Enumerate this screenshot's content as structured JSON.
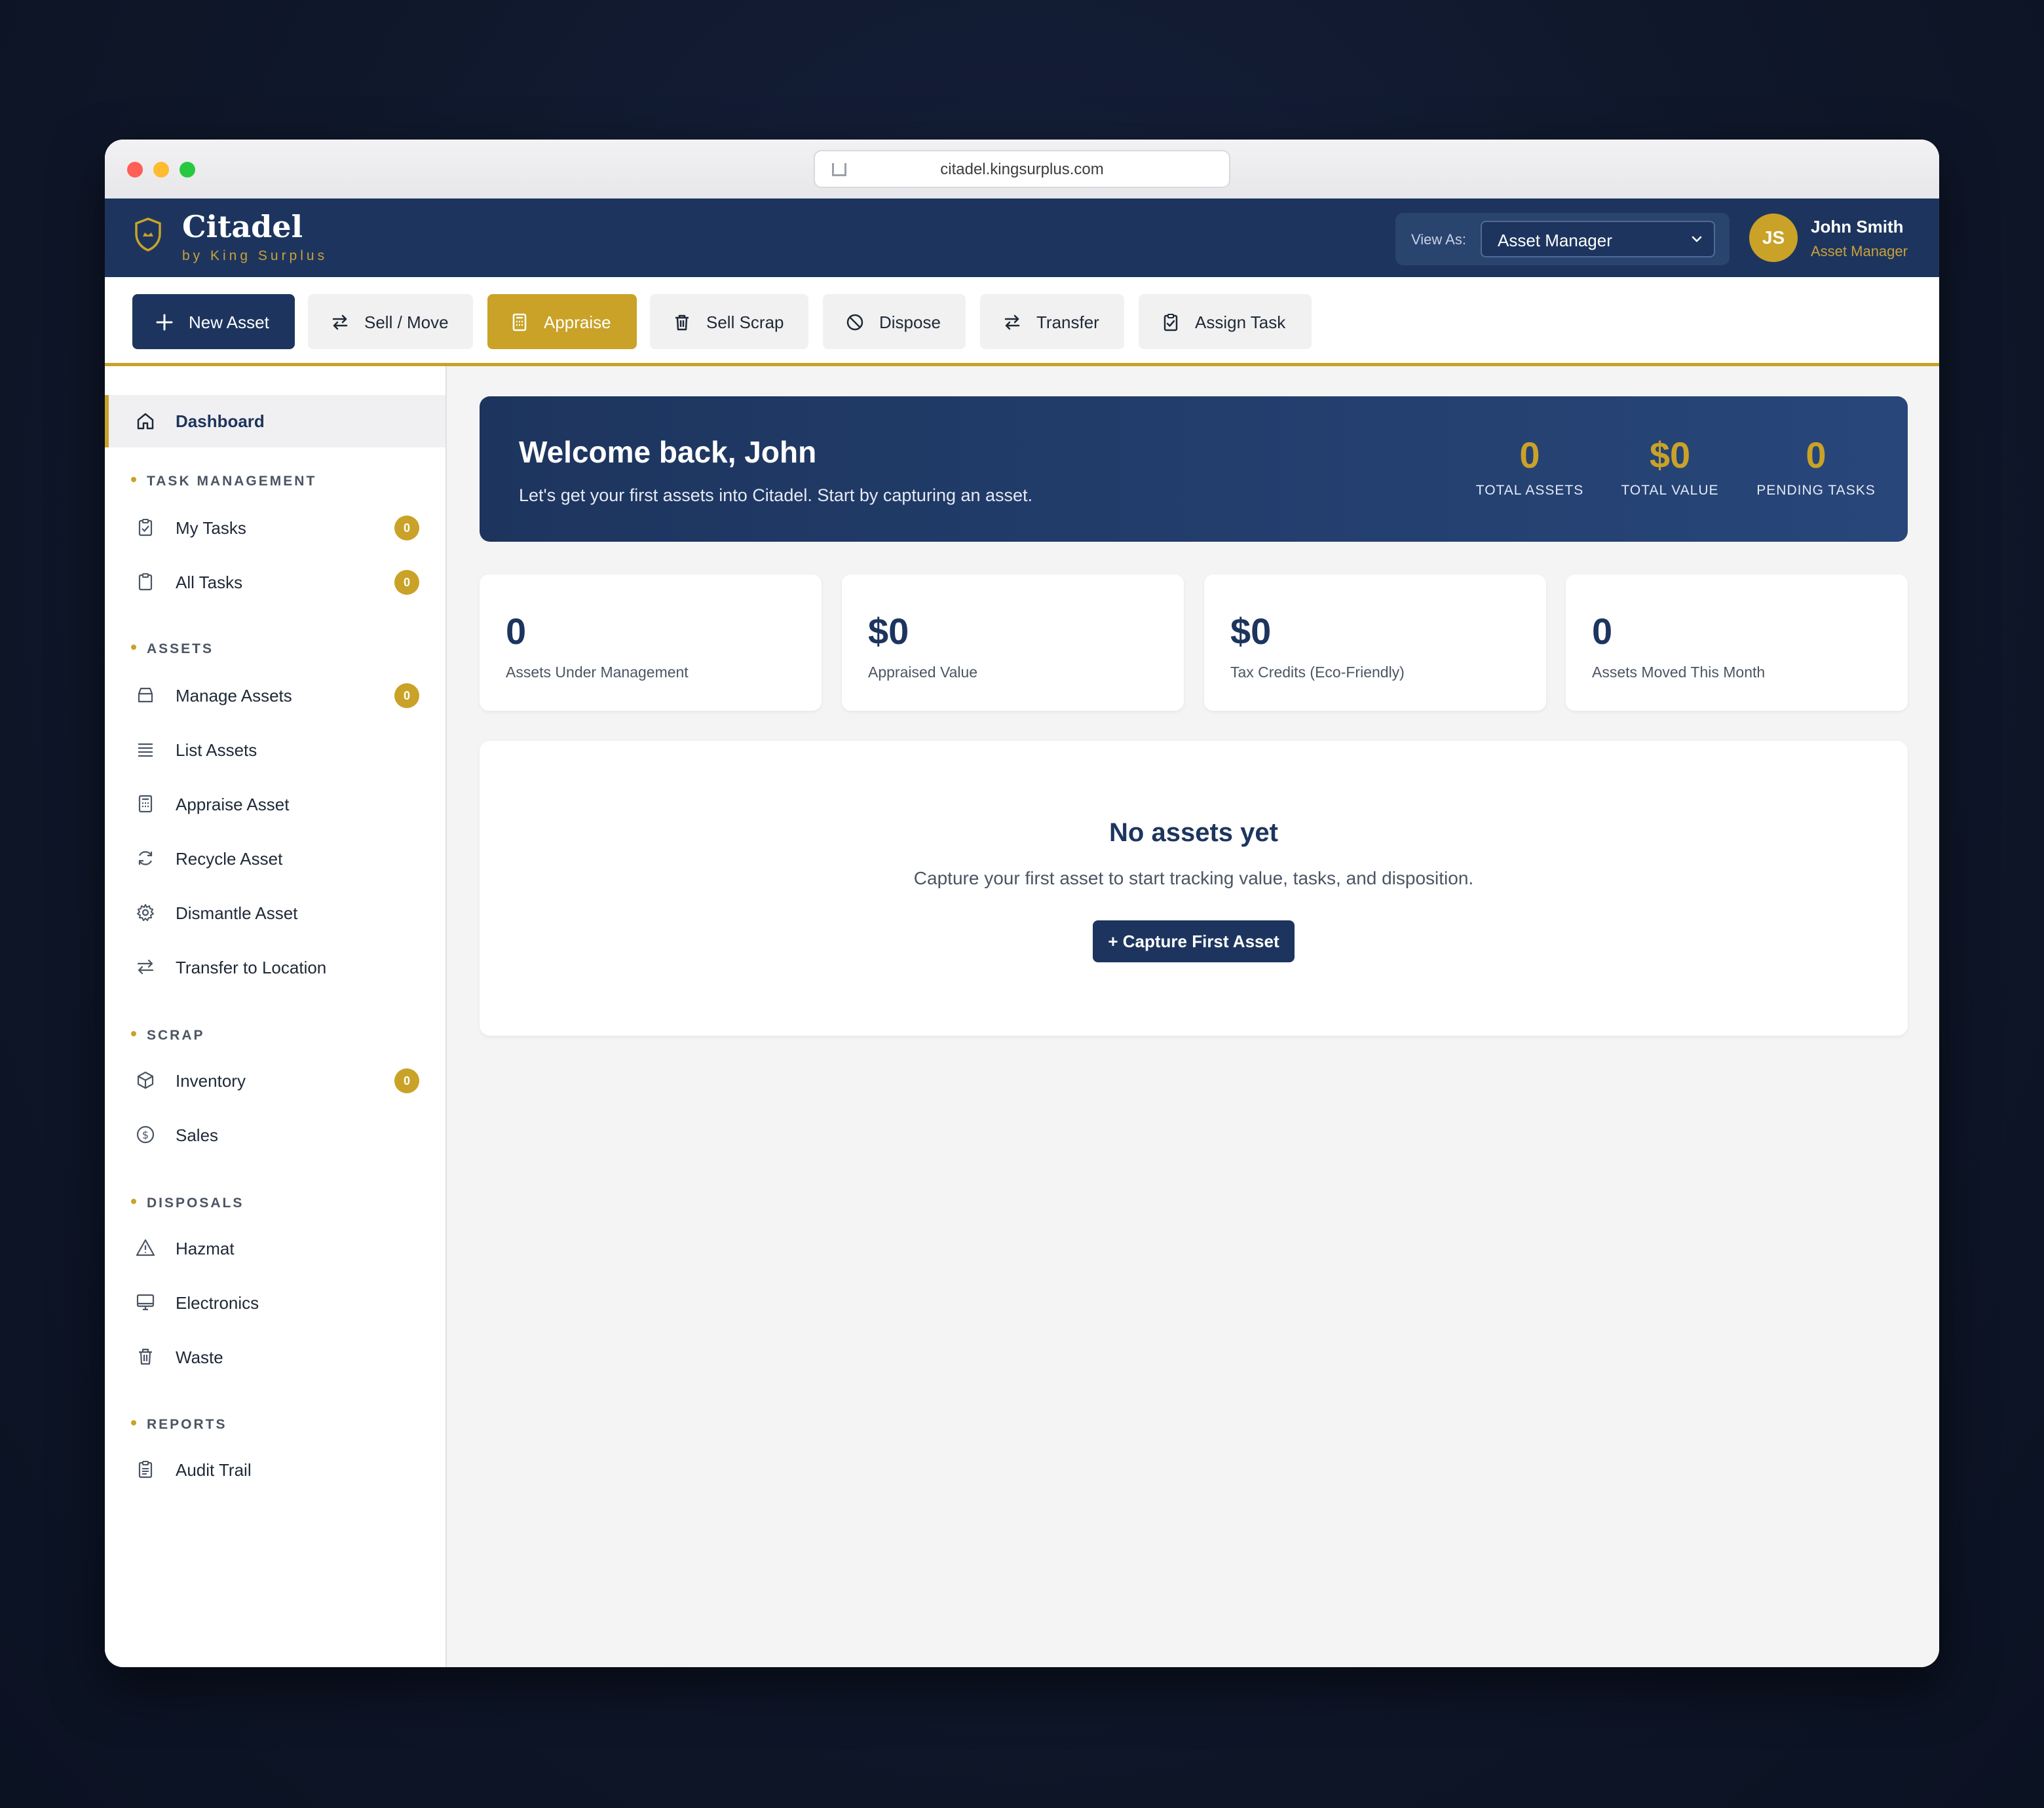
{
  "browser": {
    "url": "citadel.kingsurplus.com"
  },
  "brand": {
    "name": "Citadel",
    "tagline": "by King Surplus"
  },
  "view_as": {
    "label": "View As:",
    "selected": "Asset Manager"
  },
  "user": {
    "initials": "JS",
    "name": "John Smith",
    "role": "Asset Manager"
  },
  "toolbar": {
    "new_asset": "New Asset",
    "sell_move": "Sell / Move",
    "appraise": "Appraise",
    "sell_scrap": "Sell Scrap",
    "dispose": "Dispose",
    "transfer": "Transfer",
    "assign_task": "Assign Task"
  },
  "sidebar": {
    "dashboard": "Dashboard",
    "sections": {
      "task_management": "TASK MANAGEMENT",
      "assets": "ASSETS",
      "scrap": "SCRAP",
      "disposals": "DISPOSALS",
      "reports": "REPORTS"
    },
    "items": {
      "my_tasks": {
        "label": "My Tasks",
        "badge": "0"
      },
      "all_tasks": {
        "label": "All Tasks",
        "badge": "0"
      },
      "manage_assets": {
        "label": "Manage Assets",
        "badge": "0"
      },
      "list_assets": {
        "label": "List Assets"
      },
      "appraise_asset": {
        "label": "Appraise Asset"
      },
      "recycle_asset": {
        "label": "Recycle Asset"
      },
      "dismantle_asset": {
        "label": "Dismantle Asset"
      },
      "transfer_location": {
        "label": "Transfer to Location"
      },
      "inventory": {
        "label": "Inventory",
        "badge": "0"
      },
      "sales": {
        "label": "Sales"
      },
      "hazmat": {
        "label": "Hazmat"
      },
      "electronics": {
        "label": "Electronics"
      },
      "waste": {
        "label": "Waste"
      },
      "audit_trail": {
        "label": "Audit Trail"
      }
    }
  },
  "welcome": {
    "title": "Welcome back, John",
    "subtitle": "Let's get your first assets into Citadel. Start by capturing an asset.",
    "stats": [
      {
        "value": "0",
        "label": "TOTAL ASSETS"
      },
      {
        "value": "$0",
        "label": "TOTAL VALUE"
      },
      {
        "value": "0",
        "label": "PENDING TASKS"
      }
    ]
  },
  "cards": [
    {
      "value": "0",
      "label": "Assets Under Management"
    },
    {
      "value": "$0",
      "label": "Appraised Value"
    },
    {
      "value": "$0",
      "label": "Tax Credits (Eco-Friendly)"
    },
    {
      "value": "0",
      "label": "Assets Moved This Month"
    }
  ],
  "empty_state": {
    "title": "No assets yet",
    "subtitle": "Capture your first asset to start tracking value, tasks, and disposition.",
    "button": "+ Capture First Asset"
  },
  "colors": {
    "navy": "#1d355e",
    "gold": "#c9a227",
    "background": "#f4f4f4"
  }
}
